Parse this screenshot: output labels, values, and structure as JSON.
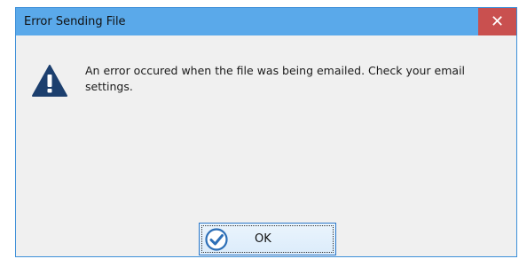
{
  "window": {
    "title": "Error Sending File",
    "close_glyph": "✕"
  },
  "message": {
    "text": "An error occured when the file was being emailed. Check your email settings.",
    "icon": "warning-icon"
  },
  "buttons": {
    "ok_label": "OK",
    "ok_icon": "checkmark-circle-icon"
  },
  "colors": {
    "titlebar": "#5aa9ea",
    "close_button": "#c9504f",
    "icon": "#1c3f6e",
    "check": "#2d6fb7"
  }
}
